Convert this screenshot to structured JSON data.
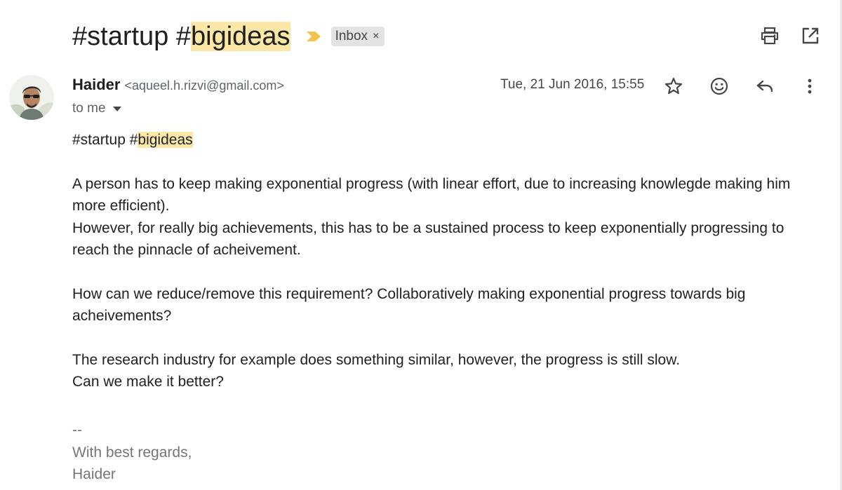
{
  "subject": {
    "prefix": "#startup #",
    "highlight": "bigideas"
  },
  "labels": [
    {
      "text": "Inbox",
      "remove_glyph": "×"
    }
  ],
  "icons": {
    "importance": "importance-marker-icon",
    "print": "print-icon",
    "open_new_window": "open-in-new-window-icon",
    "star": "star-icon",
    "emoji": "emoji-reaction-icon",
    "reply": "reply-icon",
    "more": "more-vertical-icon",
    "recipient_details": "chevron-down-icon"
  },
  "sender": {
    "name": "Haider",
    "email": "<aqueel.h.rizvi@gmail.com>",
    "recipient": "to me",
    "date": "Tue, 21 Jun 2016, 15:55"
  },
  "body": {
    "tag_prefix": "#startup #",
    "tag_highlight": "bigideas",
    "paragraph1_line1": "A person has to keep making exponential progress (with linear effort, due to increasing knowlegde making him",
    "paragraph1_line2": "more efficient).",
    "paragraph1_line3": "However, for really big achievements, this has to be a sustained process to keep exponentially progressing to",
    "paragraph1_line4": "reach the pinnacle of acheivement.",
    "paragraph2_line1": "How can we reduce/remove this requirement? Collaboratively making exponential progress towards big",
    "paragraph2_line2": "acheivements?",
    "paragraph3_line1": "The research industry for example does something similar, however, the progress is still slow.",
    "paragraph3_line2": "Can we make it better?"
  },
  "signature": {
    "separator": "--",
    "closing": "With best regards,",
    "name": "Haider"
  },
  "colors": {
    "highlight": "#fce8a6",
    "importance": "#f2c14e",
    "chip_bg": "#e3e3e3",
    "signature_text": "#757575"
  }
}
